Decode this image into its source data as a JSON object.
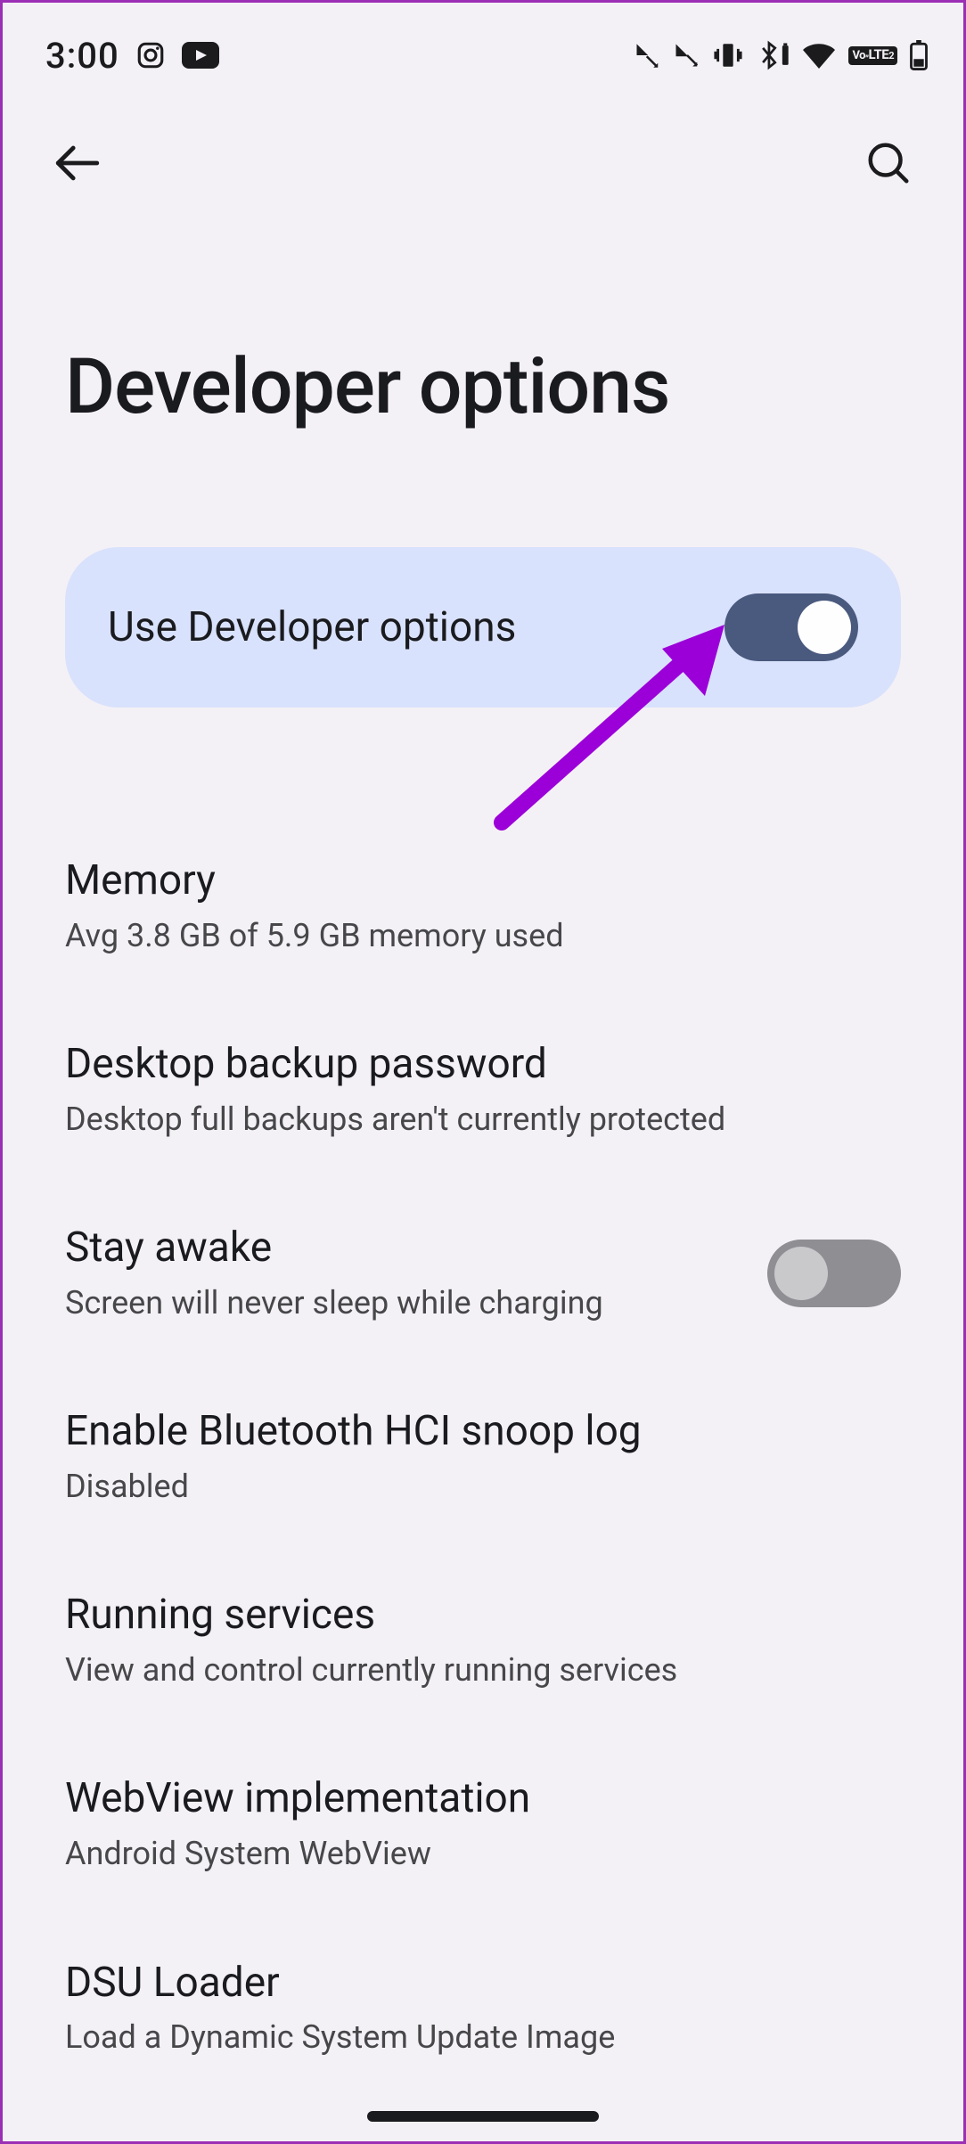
{
  "status": {
    "time": "3:00",
    "icons": {
      "instagram": "instagram-icon",
      "youtube": "youtube-icon",
      "call1": "call-missed-icon",
      "call2": "call-missed-icon",
      "vibrate": "vibrate-icon",
      "bluetooth": "bluetooth-battery-icon",
      "wifi": "wifi-icon",
      "volte": "VoLTE2",
      "battery": "battery-icon"
    }
  },
  "header": {
    "title": "Developer options"
  },
  "master_toggle": {
    "label": "Use Developer options",
    "state": "on"
  },
  "settings": [
    {
      "title": "Memory",
      "subtitle": "Avg 3.8 GB of 5.9 GB memory used",
      "toggle": null
    },
    {
      "title": "Desktop backup password",
      "subtitle": "Desktop full backups aren't currently protected",
      "toggle": null
    },
    {
      "title": "Stay awake",
      "subtitle": "Screen will never sleep while charging",
      "toggle": "off"
    },
    {
      "title": "Enable Bluetooth HCI snoop log",
      "subtitle": "Disabled",
      "toggle": null
    },
    {
      "title": "Running services",
      "subtitle": "View and control currently running services",
      "toggle": null
    },
    {
      "title": "WebView implementation",
      "subtitle": "Android System WebView",
      "toggle": null
    },
    {
      "title": "DSU Loader",
      "subtitle": "Load a Dynamic System Update Image",
      "toggle": null
    }
  ],
  "annotation": {
    "arrow_color": "#9b00d8"
  }
}
